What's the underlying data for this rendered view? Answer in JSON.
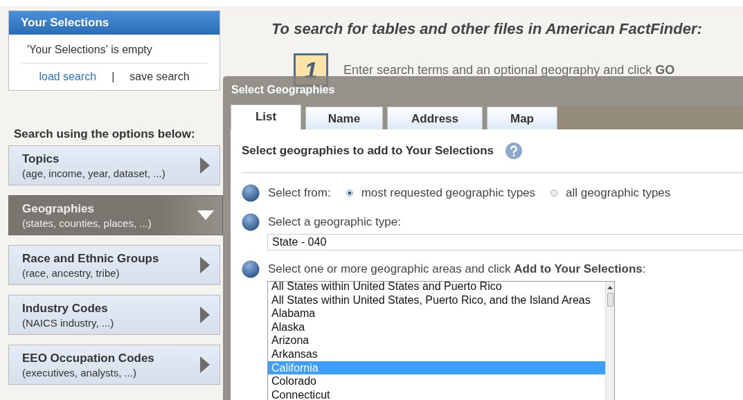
{
  "your_selections": {
    "title": "Your Selections",
    "empty_message": "'Your Selections' is empty",
    "load_search": {
      "label": "load search",
      "disabled": false
    },
    "separator": "|",
    "save_search": {
      "label": "save search",
      "disabled": true
    }
  },
  "search_options": {
    "heading": "Search using the options below:",
    "items": [
      {
        "title": "Topics",
        "subtitle": "(age, income, year, dataset, ...)",
        "selected": false
      },
      {
        "title": "Geographies",
        "subtitle": "(states, counties, places, ...)",
        "selected": true
      },
      {
        "title": "Race and Ethnic Groups",
        "subtitle": "(race, ancestry, tribe)",
        "selected": false
      },
      {
        "title": "Industry Codes",
        "subtitle": "(NAICS industry, ...)",
        "selected": false
      },
      {
        "title": "EEO Occupation Codes",
        "subtitle": "(executives, analysts, ...)",
        "selected": false
      }
    ]
  },
  "intro": {
    "heading": "To search for tables and other files in American FactFinder:",
    "step_number": "1",
    "step_text": "Enter search terms and an optional geography and click **GO**"
  },
  "dialog": {
    "title": "Select Geographies",
    "tabs": [
      {
        "label": "List",
        "selected": true
      },
      {
        "label": "Name",
        "selected": false
      },
      {
        "label": "Address",
        "selected": false
      },
      {
        "label": "Map",
        "selected": false
      }
    ],
    "heading": "Select geographies to add to Your Selections",
    "steps": [
      {
        "kind": "radios",
        "label": "Select from:",
        "options": [
          {
            "label": "most requested geographic types",
            "selected": true
          },
          {
            "label": "all geographic types",
            "selected": false
          }
        ]
      },
      {
        "kind": "dropdown",
        "label": "Select a geographic type:",
        "value": "State - 040"
      },
      {
        "kind": "listbox",
        "label": "Select one or more geographic areas and click **Add to Your Selections**:",
        "items": [
          {
            "label": "All States within United States and Puerto Rico",
            "selected": false
          },
          {
            "label": "All States within United States, Puerto Rico, and the Island Areas",
            "selected": false
          },
          {
            "label": "Alabama",
            "selected": false
          },
          {
            "label": "Alaska",
            "selected": false
          },
          {
            "label": "Arizona",
            "selected": false
          },
          {
            "label": "Arkansas",
            "selected": false
          },
          {
            "label": "California",
            "selected": true
          },
          {
            "label": "Colorado",
            "selected": false
          },
          {
            "label": "Connecticut",
            "selected": false
          }
        ]
      }
    ]
  }
}
